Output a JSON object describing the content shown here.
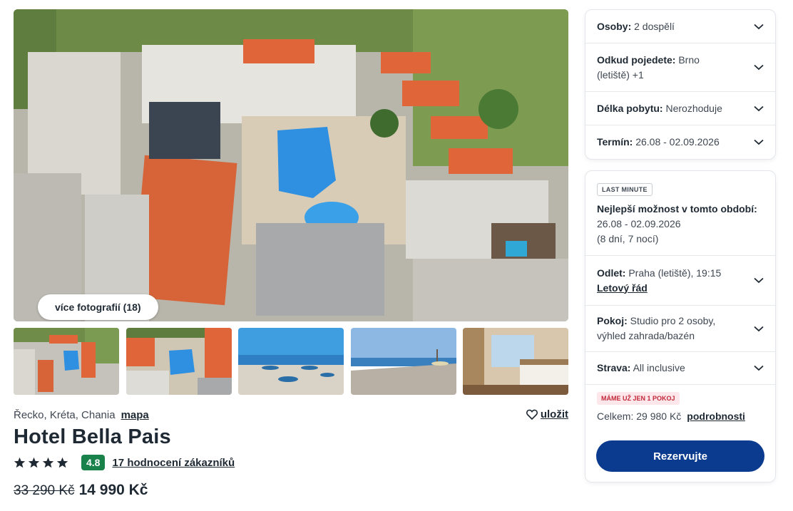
{
  "gallery": {
    "more_photos_label": "více fotografií (18)",
    "thumbnails": [
      "aerial-resort",
      "aerial-pool",
      "beach-umbrellas",
      "beach-shore",
      "hotel-room"
    ]
  },
  "hotel": {
    "location": "Řecko, Kréta, Chania",
    "map_link": "mapa",
    "save_label": "uložit",
    "name": "Hotel Bella Pais",
    "stars": 4,
    "score": "4.8",
    "reviews_label": "17 hodnocení zákazníků",
    "old_price": "33 290 Kč",
    "price": "14 990 Kč"
  },
  "filters": {
    "persons_label": "Osoby:",
    "persons_value": "2 dospělí",
    "from_label": "Odkud pojedete:",
    "from_value": "Brno",
    "from_value_2": "(letiště) +1",
    "length_label": "Délka pobytu:",
    "length_value": "Nerozhoduje",
    "term_label": "Termín:",
    "term_value": "26.08 - 02.09.2026"
  },
  "offer": {
    "badge": "LAST MINUTE",
    "best_title": "Nejlepší možnost v tomto období:",
    "best_dates": "26.08 - 02.09.2026",
    "best_nights": "(8 dní, 7 nocí)",
    "departure_label": "Odlet:",
    "departure_value": "Praha (letiště), 19:15",
    "schedule_link": "Letový řád",
    "room_label": "Pokoj:",
    "room_value": "Studio pro 2 osoby,",
    "room_value_2": "výhled zahrada/bazén",
    "board_label": "Strava:",
    "board_value": "All inclusive",
    "availability_badge": "MÁME UŽ JEN 1 POKOJ",
    "total_text": "Celkem: 29 980 Kč",
    "details_link": "podrobnosti",
    "reserve_label": "Rezervujte"
  },
  "colors": {
    "accent": "#0b3b8f",
    "score_badge": "#19824a",
    "alert": "#c2283a"
  }
}
